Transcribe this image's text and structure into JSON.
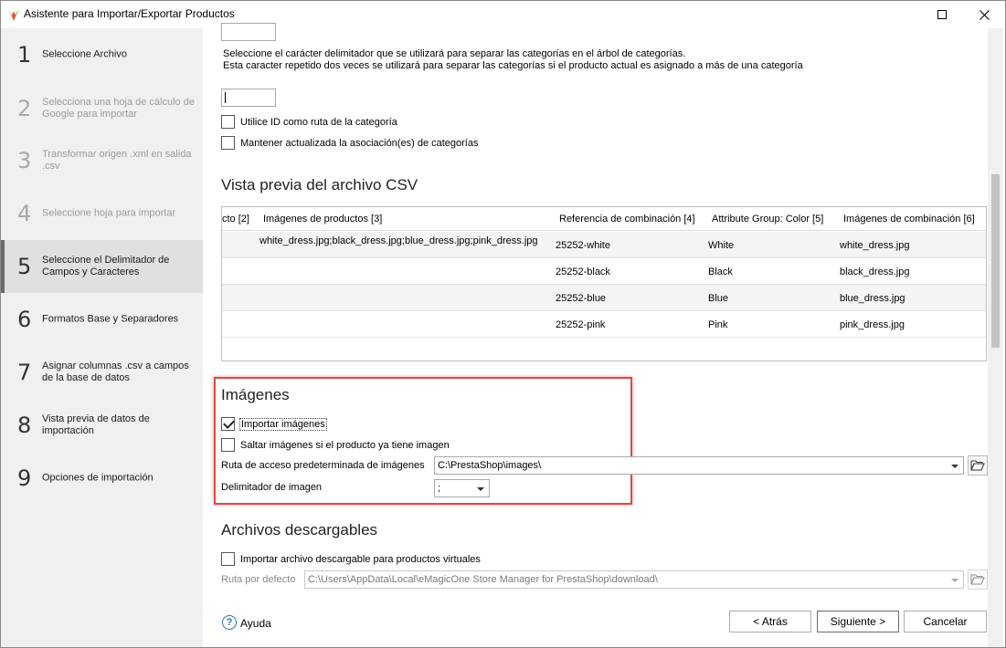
{
  "window": {
    "title": "Asistente para Importar/Exportar Productos"
  },
  "sidebar": {
    "steps": [
      {
        "num": "1",
        "label": "Seleccione Archivo"
      },
      {
        "num": "2",
        "label": "Selecciona una hoja de cálculo de Google para importar"
      },
      {
        "num": "3",
        "label": "Transformar origen .xml en salida .csv"
      },
      {
        "num": "4",
        "label": "Seleccione hoja para importar"
      },
      {
        "num": "5",
        "label": "Seleccione el Delimitador de Campos y Caracteres"
      },
      {
        "num": "6",
        "label": "Formatos Base y Separadores"
      },
      {
        "num": "7",
        "label": "Asignar columnas .csv a campos de la base de datos"
      },
      {
        "num": "8",
        "label": "Vista previa de datos de importación"
      },
      {
        "num": "9",
        "label": "Opciones de importación"
      }
    ]
  },
  "categories": {
    "desc_line1": "Seleccione el carácter delimitador que se utilizará para separar las categorías en el árbol de categorías.",
    "desc_line2": "Esta caracter repetido dos veces se utilizará para separar las categorías si el producto actual es asignado a más de una categoría",
    "use_id_label": "Utilice ID como ruta de la categoría",
    "keep_updated_label": "Mantener actualizada la asociación(es) de categorías"
  },
  "preview": {
    "title": "Vista previa del archivo CSV",
    "columns": [
      "cto [2]",
      "Imágenes de productos [3]",
      "Referencia de combinación [4]",
      "Attribute Group: Color [5]",
      "Imágenes de combinación [6]"
    ],
    "rows": [
      [
        "",
        "white_dress.jpg;black_dress.jpg;blue_dress.jpg;pink_dress.jpg",
        "25252-white",
        "White",
        "white_dress.jpg"
      ],
      [
        "",
        "",
        "25252-black",
        "Black",
        "black_dress.jpg"
      ],
      [
        "",
        "",
        "25252-blue",
        "Blue",
        "blue_dress.jpg"
      ],
      [
        "",
        "",
        "25252-pink",
        "Pink",
        "pink_dress.jpg"
      ]
    ]
  },
  "images": {
    "title": "Imágenes",
    "import_label": "Importar imágenes",
    "import_checked": true,
    "skip_label": "Saltar imágenes si el producto ya tiene imagen",
    "skip_checked": false,
    "path_label": "Ruta de acceso predeterminada de imágenes",
    "path_value": "C:\\PrestaShop\\images\\",
    "delimiter_label": "Delimitador de imagen",
    "delimiter_value": ";"
  },
  "downloads": {
    "title": "Archivos descargables",
    "import_label": "Importar archivo descargable para productos virtuales",
    "path_label": "Ruta por defecto",
    "path_value": "C:\\Users\\AppData\\Local\\eMagicOne Store Manager for PrestaShop\\download\\"
  },
  "footer": {
    "help_label": "Ayuda",
    "back_label": "< Atrás",
    "next_label": "Siguiente >",
    "cancel_label": "Cancelar"
  },
  "colors": {
    "highlight": "#e04848",
    "active_step_bg": "#e0e0e0",
    "sidebar_bg": "#f0f0f0"
  },
  "icons": {
    "app": "app-logo-icon",
    "maximize": "maximize-icon",
    "close": "close-icon",
    "folder": "folder-open-icon",
    "help": "help-icon",
    "dropdown": "chevron-down-icon"
  }
}
